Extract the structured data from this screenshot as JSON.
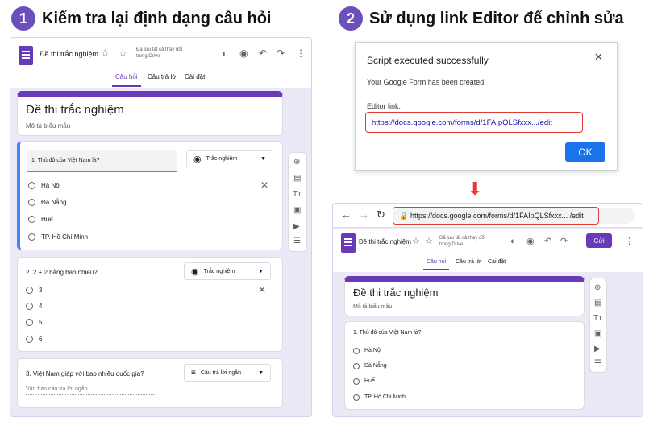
{
  "step1": {
    "number": "1",
    "title": "Kiểm tra lại định dạng câu hỏi"
  },
  "step2": {
    "number": "2",
    "title": "Sử dụng link Editor để chỉnh sửa"
  },
  "form": {
    "title": "Đề thi trắc nghiệm",
    "saved_note": "Đã lưu tất cả thay đổi trong Drive",
    "tabs": [
      "Câu hỏi",
      "Câu trả lời",
      "Cài đặt"
    ],
    "form_title": "Đề thi trắc nghiệm",
    "description": "Mô tả biểu mẫu",
    "send_label": "Gửi"
  },
  "questions": [
    {
      "text": "1. Thủ đô của Việt Nam là?",
      "type": "Trắc nghiệm",
      "options": [
        "Hà Nội",
        "Đà Nẵng",
        "Huế",
        "TP. Hồ Chí Minh"
      ]
    },
    {
      "text": "2. 2 + 2 bằng bao nhiêu?",
      "type": "Trắc nghiệm",
      "options": [
        "3",
        "4",
        "5",
        "6"
      ]
    },
    {
      "text": "3. Việt Nam giáp với bao nhiêu quốc gia?",
      "type": "Câu trả lời ngắn",
      "placeholder": "Văn bản câu trả lời ngắn"
    }
  ],
  "dialog": {
    "title": "Script executed successfully",
    "message": "Your Google Form has been created!",
    "editor_label": "Editor link:",
    "link": "https://docs.google.com/forms/d/1FAIpQLSfxxx.../edit",
    "ok_label": "OK",
    "close": "✕"
  },
  "browser": {
    "url": "https://docs.google.com/forms/d/1FAIpQLSfxxx... /edit"
  },
  "arrow": "⬇",
  "colors": {
    "accent": "#673ab7",
    "step_badge": "#6b4fbb",
    "highlight": "#e53935",
    "ok": "#1a73e8"
  },
  "icons": [
    "star-icon",
    "palette-icon",
    "eye-icon",
    "undo-icon",
    "redo-icon",
    "more-icon",
    "close-icon",
    "add-icon",
    "import-icon",
    "title-icon",
    "image-icon",
    "video-icon",
    "section-icon"
  ]
}
